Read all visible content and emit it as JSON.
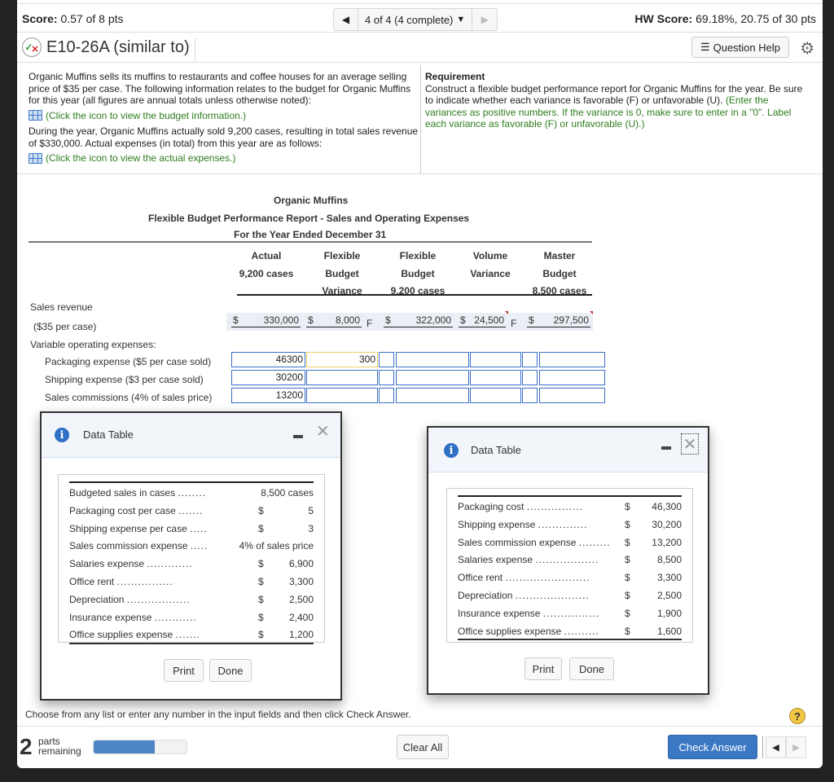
{
  "header": {
    "score_label": "Score:",
    "score_value": "0.57 of 8 pts",
    "nav_label": "4 of 4 (4 complete)",
    "hw_score_label": "HW Score:",
    "hw_score_value": "69.18%, 20.75 of 30 pts",
    "question_title": "E10-26A (similar to)",
    "question_help_label": "Question Help"
  },
  "problem": {
    "para1": "Organic Muffins sells its muffins to restaurants and coffee houses for an average selling price of $35 per case. The following information relates to the budget for Organic Muffins for this year (all figures are annual totals unless otherwise noted):",
    "link1": "(Click the icon to view the budget information.)",
    "para2": "During the year, Organic Muffins actually sold 9,200 cases, resulting in total sales revenue of $330,000. Actual expenses (in total) from this year are as follows:",
    "link2": "(Click the icon to view the actual expenses.)",
    "requirement_title": "Requirement",
    "requirement_text": "Construct a flexible budget performance report for Organic Muffins for the year. Be sure to indicate whether each variance is favorable (F) or unfavorable (U). ",
    "requirement_hint": "(Enter the variances as positive numbers. If the variance is 0, make sure to enter in a \"0\". Label each variance as favorable (F) or unfavorable (U).)"
  },
  "report": {
    "company": "Organic Muffins",
    "title": "Flexible Budget Performance Report - Sales and Operating Expenses",
    "period": "For the Year Ended December 31",
    "columns": [
      {
        "l1": "",
        "l2": "Actual",
        "l3": "9,200 cases"
      },
      {
        "l1": "Flexible",
        "l2": "Budget",
        "l3": "Variance"
      },
      {
        "l1": "Flexible",
        "l2": "Budget",
        "l3": "9,200 cases"
      },
      {
        "l1": "",
        "l2": "Volume",
        "l3": "Variance"
      },
      {
        "l1": "Master",
        "l2": "Budget",
        "l3": "8,500 cases"
      }
    ],
    "sales_label": "Sales revenue",
    "sales_sub": "($35 per case)",
    "sales": {
      "actual": "330,000",
      "fb_variance": "8,000",
      "fb_variance_fu": "F",
      "flexible": "322,000",
      "vol_variance": "24,500",
      "vol_variance_fu": "F",
      "master": "297,500",
      "currency": "$"
    },
    "var_header": "Variable operating expenses:",
    "rows": [
      {
        "label": "Packaging expense ($5 per case sold)",
        "actual": "46300",
        "fb_variance": "300",
        "fb_fu": "",
        "flexible": "",
        "vol_variance": "",
        "vol_fu": "",
        "master": ""
      },
      {
        "label": "Shipping expense ($3 per case sold)",
        "actual": "30200",
        "fb_variance": "",
        "fb_fu": "",
        "flexible": "",
        "vol_variance": "",
        "vol_fu": "",
        "master": ""
      },
      {
        "label": "Sales commissions (4% of sales price)",
        "actual": "13200",
        "fb_variance": "",
        "fb_fu": "",
        "flexible": "",
        "vol_variance": "",
        "vol_fu": "",
        "master": ""
      }
    ]
  },
  "dialog_budget": {
    "title": "Data Table",
    "rows": [
      {
        "name": "Budgeted sales in cases",
        "dots": "........",
        "dollar": "",
        "value": "8,500 cases"
      },
      {
        "name": "Packaging cost per case",
        "dots": ".......",
        "dollar": "$",
        "value": "5"
      },
      {
        "name": "Shipping expense per case",
        "dots": ".....",
        "dollar": "$",
        "value": "3"
      },
      {
        "name": "Sales commission expense",
        "dots": ".....",
        "dollar": "",
        "value": "4% of sales price"
      },
      {
        "name": "Salaries expense",
        "dots": ".............",
        "dollar": "$",
        "value": "6,900"
      },
      {
        "name": "Office rent",
        "dots": "................",
        "dollar": "$",
        "value": "3,300"
      },
      {
        "name": "Depreciation",
        "dots": "..................",
        "dollar": "$",
        "value": "2,500"
      },
      {
        "name": "Insurance expense",
        "dots": "............",
        "dollar": "$",
        "value": "2,400"
      },
      {
        "name": "Office supplies expense",
        "dots": ".......",
        "dollar": "$",
        "value": "1,200"
      }
    ],
    "print_label": "Print",
    "done_label": "Done"
  },
  "dialog_actual": {
    "title": "Data Table",
    "rows": [
      {
        "name": "Packaging cost",
        "dots": "................",
        "dollar": "$",
        "value": "46,300"
      },
      {
        "name": "Shipping expense",
        "dots": "..............",
        "dollar": "$",
        "value": "30,200"
      },
      {
        "name": "Sales commission expense",
        "dots": ".........",
        "dollar": "$",
        "value": "13,200"
      },
      {
        "name": "Salaries expense",
        "dots": "..................",
        "dollar": "$",
        "value": "8,500"
      },
      {
        "name": "Office rent",
        "dots": "........................",
        "dollar": "$",
        "value": "3,300"
      },
      {
        "name": "Depreciation",
        "dots": ".....................",
        "dollar": "$",
        "value": "2,500"
      },
      {
        "name": "Insurance expense",
        "dots": "................",
        "dollar": "$",
        "value": "1,900"
      },
      {
        "name": "Office supplies expense",
        "dots": "..........",
        "dollar": "$",
        "value": "1,600"
      }
    ],
    "print_label": "Print",
    "done_label": "Done"
  },
  "footer": {
    "instruction": "Choose from any list or enter any number in the input fields and then click Check Answer.",
    "parts_count": "2",
    "parts_label_1": "parts",
    "parts_label_2": "remaining",
    "progress_fraction": 0.66,
    "clear_all_label": "Clear All",
    "check_answer_label": "Check Answer"
  }
}
